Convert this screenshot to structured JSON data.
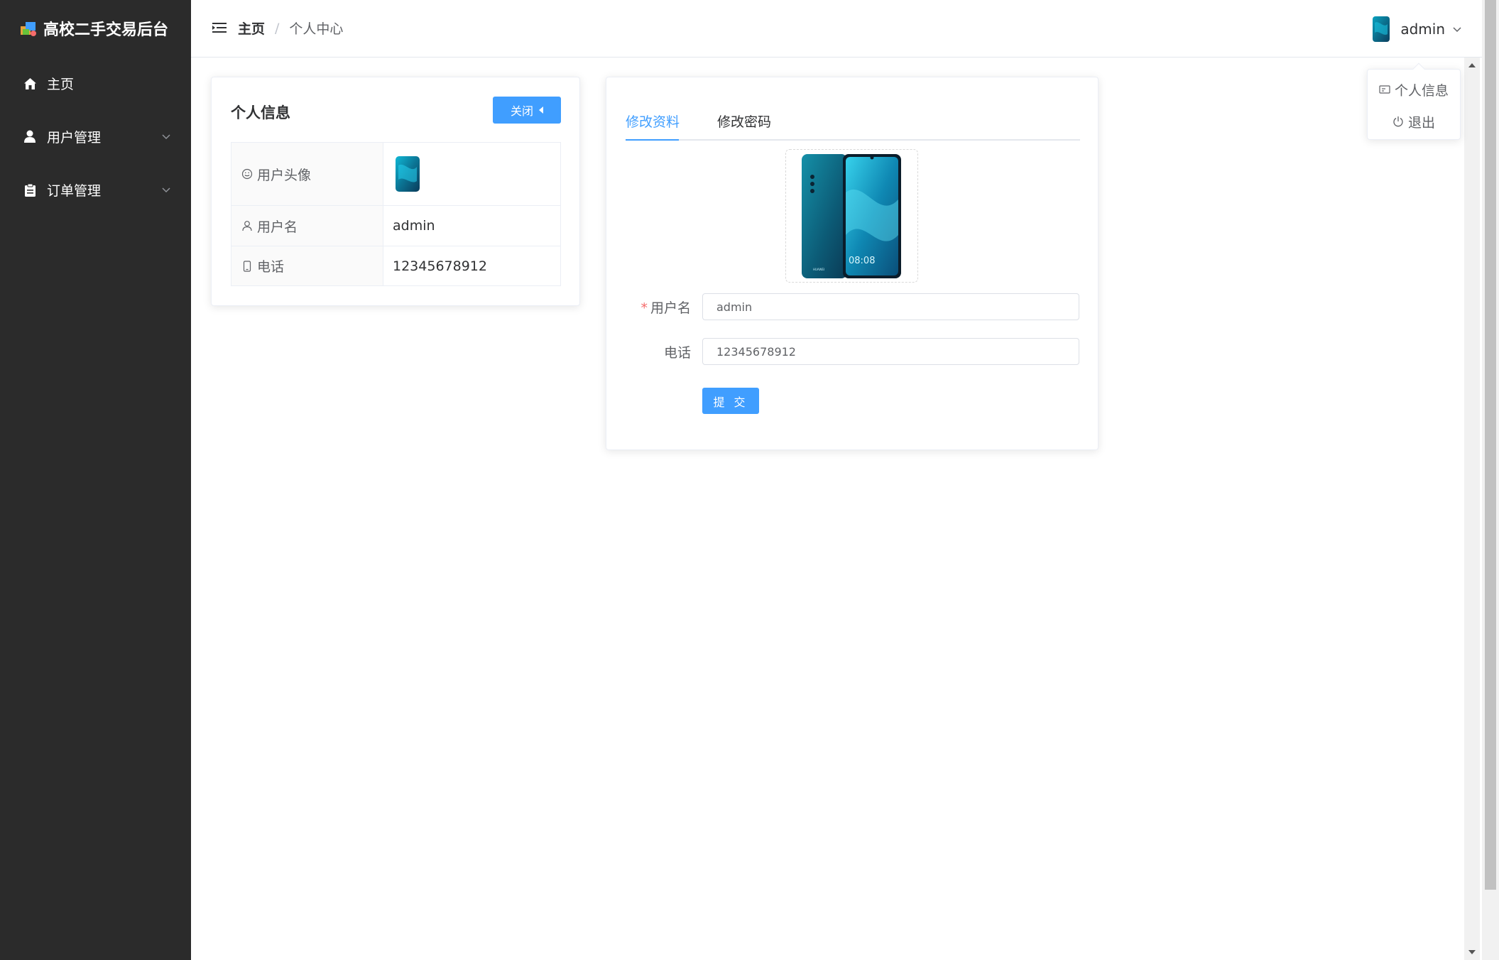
{
  "app": {
    "title": "高校二手交易后台"
  },
  "sidebar": {
    "items": [
      {
        "label": "主页",
        "icon": "home-icon"
      },
      {
        "label": "用户管理",
        "icon": "user-icon"
      },
      {
        "label": "订单管理",
        "icon": "clipboard-icon"
      }
    ]
  },
  "header": {
    "breadcrumb": {
      "home": "主页",
      "separator": "/",
      "current": "个人中心"
    },
    "user": {
      "name": "admin"
    }
  },
  "dropdown": {
    "items": [
      {
        "label": "个人信息",
        "icon": "id-card-icon"
      },
      {
        "label": "退出",
        "icon": "power-icon"
      }
    ]
  },
  "profile_card": {
    "title": "个人信息",
    "close_label": "关闭",
    "rows": [
      {
        "label": "用户头像",
        "icon": "smile-icon"
      },
      {
        "label": "用户名",
        "icon": "user-outline-icon",
        "value": "admin"
      },
      {
        "label": "电话",
        "icon": "phone-icon",
        "value": "12345678912"
      }
    ]
  },
  "edit_card": {
    "tabs": [
      {
        "label": "修改资料"
      },
      {
        "label": "修改密码"
      }
    ],
    "username_label": "用户名",
    "required_mark": "*",
    "username_value": "admin",
    "phone_label": "电话",
    "phone_value": "12345678912",
    "submit_label": "提 交",
    "phone_screen_time": "08:08"
  },
  "colors": {
    "primary": "#409eff",
    "sidebar_bg": "#2b2b2b",
    "danger": "#f56c6c"
  }
}
